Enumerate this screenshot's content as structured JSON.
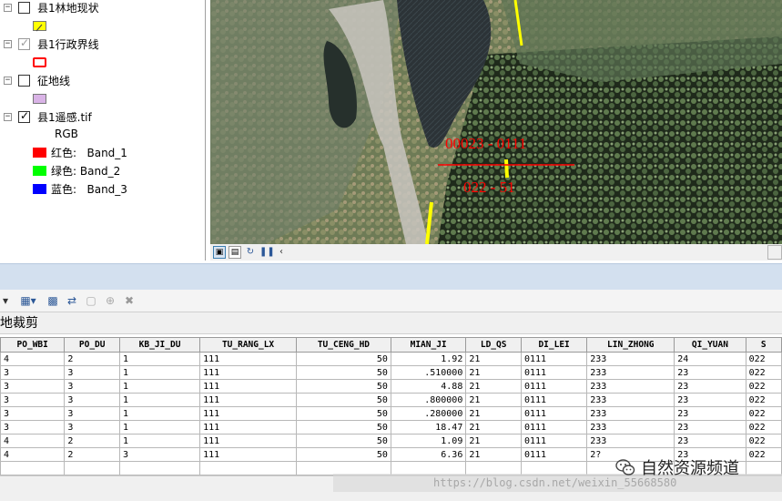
{
  "toc": {
    "layers": [
      {
        "name": "县1林地现状",
        "checked": false
      },
      {
        "name": "县1行政界线",
        "checked": true
      },
      {
        "name": "征地线",
        "checked": false
      },
      {
        "name": "县1遥感.tif",
        "checked": true
      }
    ],
    "raster": {
      "composite": "RGB",
      "bands": [
        {
          "label": "红色:   Band_1",
          "color": "#ff0000"
        },
        {
          "label": "绿色: Band_2",
          "color": "#00ff00"
        },
        {
          "label": "蓝色:   Band_3",
          "color": "#0000ff"
        }
      ]
    },
    "colors": {
      "linde_symbol": "#ffff00",
      "boundary_symbol": "#ff0000",
      "zhengdi_symbol": "#d9b3e6"
    }
  },
  "map": {
    "label_line1": "00023 - 0111",
    "label_line2": "022 - 51",
    "label_color": "#ff0000"
  },
  "table": {
    "title": "地裁剪",
    "columns": [
      "PO_WBI",
      "PO_DU",
      "KB_JI_DU",
      "TU_RANG_LX",
      "TU_CENG_HD",
      "MIAN_JI",
      "LD_QS",
      "DI_LEI",
      "LIN_ZHONG",
      "QI_YUAN",
      "S"
    ],
    "rows": [
      [
        "4",
        "2",
        "1",
        "111",
        "50",
        "1.92",
        "21",
        "0111",
        "233",
        "24",
        "022"
      ],
      [
        "3",
        "3",
        "1",
        "111",
        "50",
        ".510000",
        "21",
        "0111",
        "233",
        "23",
        "022"
      ],
      [
        "3",
        "3",
        "1",
        "111",
        "50",
        "4.88",
        "21",
        "0111",
        "233",
        "23",
        "022"
      ],
      [
        "3",
        "3",
        "1",
        "111",
        "50",
        ".800000",
        "21",
        "0111",
        "233",
        "23",
        "022"
      ],
      [
        "3",
        "3",
        "1",
        "111",
        "50",
        ".280000",
        "21",
        "0111",
        "233",
        "23",
        "022"
      ],
      [
        "3",
        "3",
        "1",
        "111",
        "50",
        "18.47",
        "21",
        "0111",
        "233",
        "23",
        "022"
      ],
      [
        "4",
        "2",
        "1",
        "111",
        "50",
        "1.09",
        "21",
        "0111",
        "233",
        "23",
        "022"
      ],
      [
        "4",
        "2",
        "3",
        "111",
        "50",
        "6.36",
        "21",
        "0111",
        "2?",
        "23",
        "022"
      ]
    ]
  },
  "watermark": {
    "url": "https://blog.csdn.net/weixin_55668580",
    "channel": "自然资源频道"
  }
}
